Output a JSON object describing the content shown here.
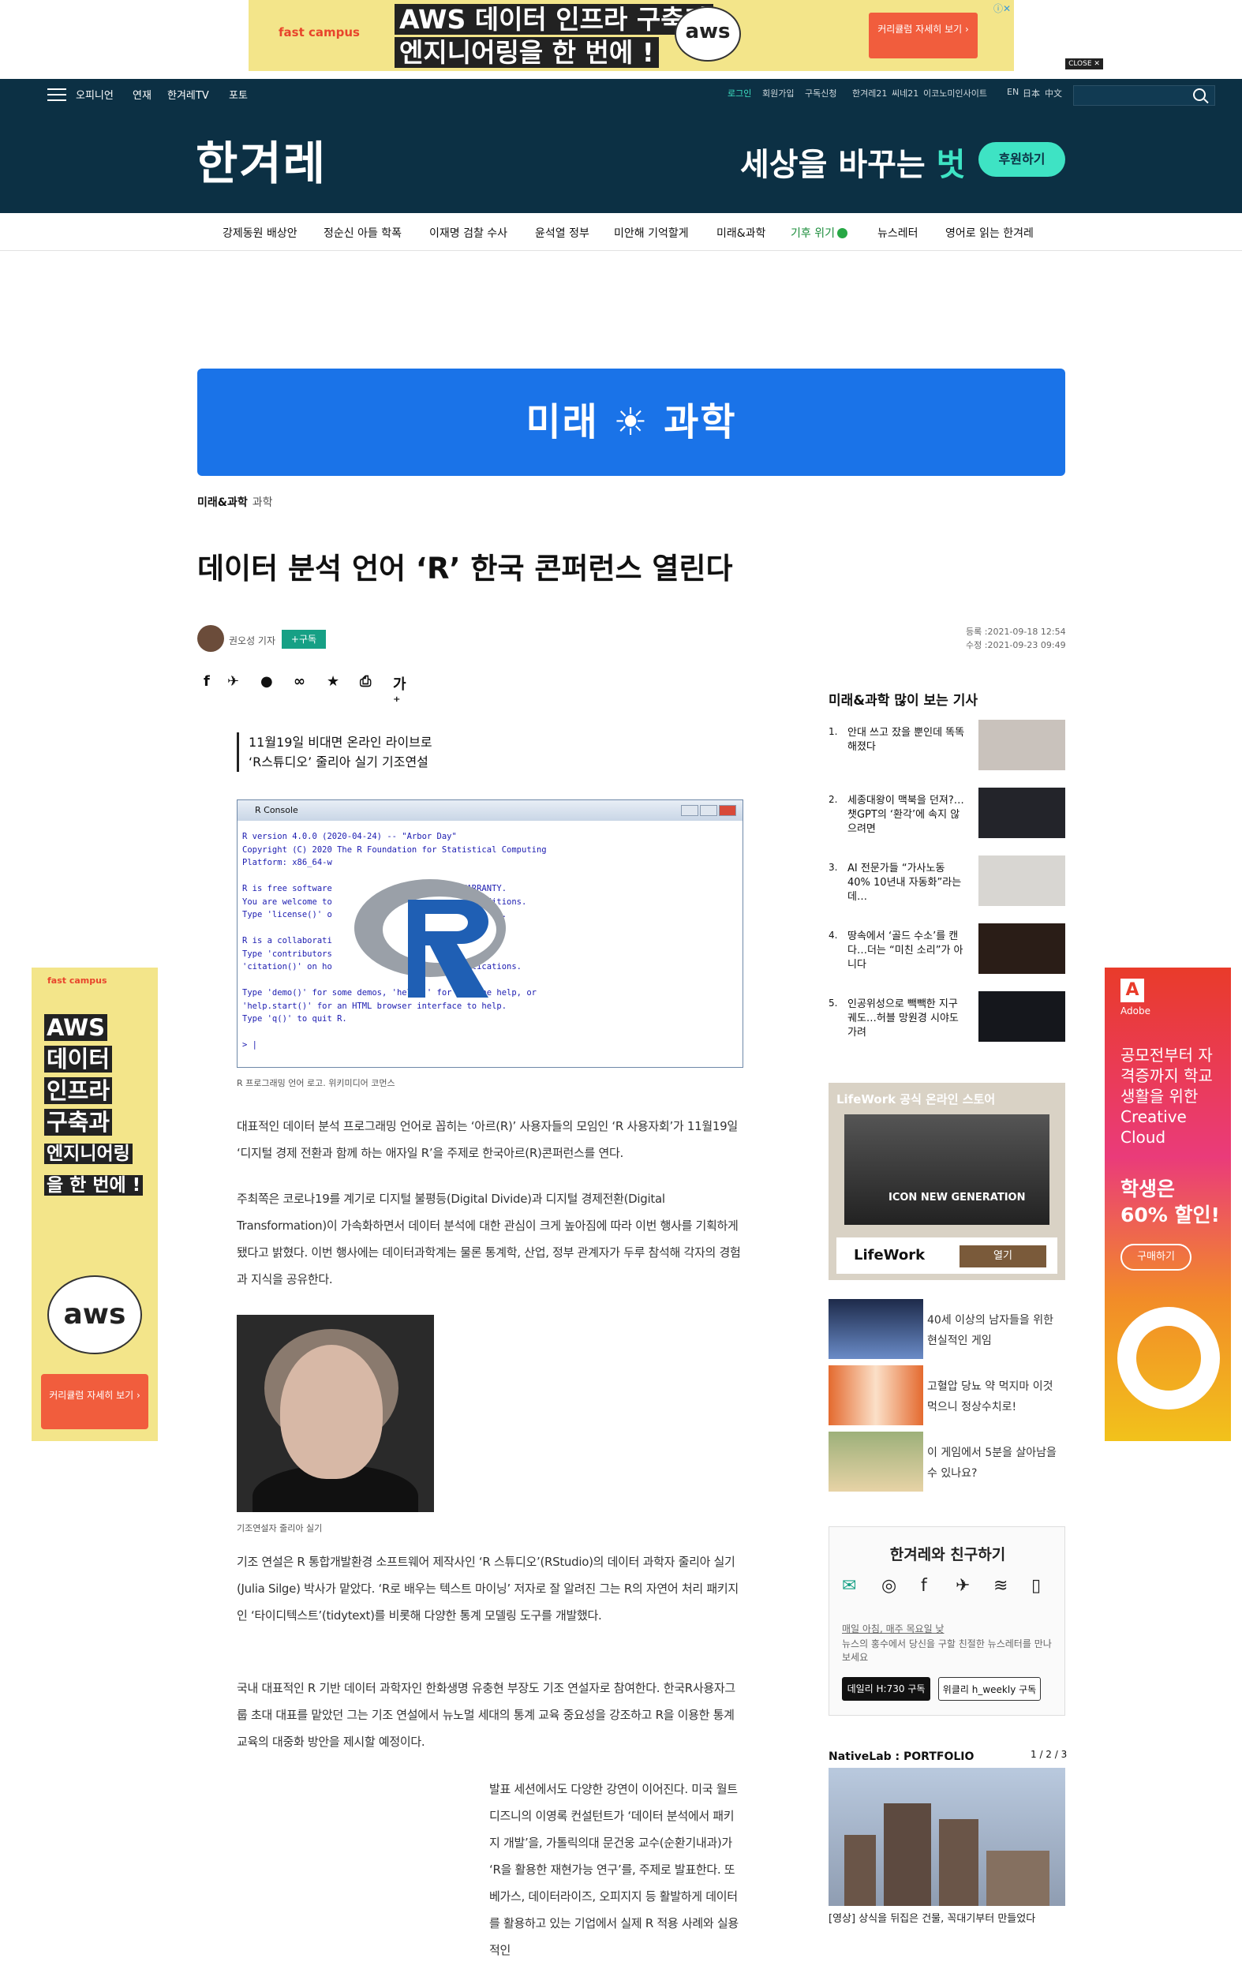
{
  "top_ad": {
    "brand": "fast campus",
    "headline_line1": "AWS 데이터 인프라 구축과",
    "headline_line2": "엔지니어링을 한 번에 !",
    "aws_logo": "aws",
    "cta": "커리큘럼 자세히 보기 ›",
    "ad_mark": "ⓘ✕",
    "close_label": "CLOSE ✕"
  },
  "header": {
    "nav": [
      "오피니언",
      "연재",
      "한겨레TV",
      "포토"
    ],
    "util": [
      "로그인",
      "회원가입",
      "구독신청",
      "한겨레21",
      "씨네21",
      "이코노미인사이트",
      "EN",
      "日本",
      "中文"
    ],
    "logo": "한겨레",
    "slogan_prefix": "세상을 바꾸는 ",
    "slogan_highlight": "벗",
    "support_button": "후원하기"
  },
  "topics": [
    "강제동원 배상안",
    "정순신 아들 학폭",
    "이재명 검찰 수사",
    "윤석열 정부",
    "미안해 기억할게",
    "미래&과학",
    "기후 위기",
    "뉴스레터",
    "영어로 읽는 한겨레"
  ],
  "section_banner": "미래 ☀ 과학",
  "breadcrumb": {
    "main": "미래&과학",
    "sub": "과학"
  },
  "article": {
    "title": "데이터 분석 언어 ‘R’ 한국 콘퍼런스 열린다",
    "reporter": "권오성 기자",
    "subscribe": "+구독",
    "registered": "등록 :2021-09-18 12:54",
    "modified": "수정 :2021-09-23 09:49",
    "summary_line1": "11월19일 비대면 온라인 라이브로",
    "summary_line2": "‘R스튜디오’ 줄리아 실기 기조연설",
    "console_title": "R Console",
    "console_text": "R version 4.0.0 (2020-04-24) -- \"Arbor Day\"\nCopyright (C) 2020 The R Foundation for Statistical Computing\nPlatform: x86_64-w\n\nR is free software                       NO WARRANTY.\nYou are welcome to                       tain conditions.\nType 'license()' o                       ion details.\n\nR is a collaborati                       ibutors.\nType 'contributors                       d\n'citation()' on ho                       n publications.\n\nType 'demo()' for some demos, 'help()' for on-line help, or\n'help.start()' for an HTML browser interface to help.\nType 'q()' to quit R.\n\n> |",
    "caption1": "R 프로그래밍 언어 로고. 위키미디어 코먼스",
    "para1": "대표적인 데이터 분석 프로그래밍 언어로 꼽히는 ‘아르(R)’ 사용자들의 모임인 ‘R 사용자회’가 11월19일 ‘디지털 경제 전환과 함께 하는 애자일 R’을 주제로 한국아르(R)콘퍼런스를 연다.",
    "para2": "주최쪽은 코로나19를 계기로 디지털 불평등(Digital Divide)과 디지털 경제전환(Digital Transformation)이 가속화하면서 데이터 분석에 대한 관심이 크게 높아짐에 따라 이번 행사를 기획하게 됐다고 밝혔다. 이번 행사에는 데이터과학계는 물론 통계학, 산업, 정부 관계자가 두루 참석해 각자의 경험과 지식을 공유한다.",
    "caption2": "기조연설자 줄리아 실기",
    "para3": "기조 연설은 R 통합개발환경 소프트웨어 제작사인 ‘R 스튜디오’(RStudio)의 데이터 과학자 줄리아 실기(Julia Silge) 박사가 맡았다. ‘R로 배우는 텍스트 마이닝’ 저자로 잘 알려진 그는 R의 자연어 처리 패키지인 ‘타이디텍스트’(tidytext)를 비롯해 다양한 통계 모델링 도구를 개발했다.",
    "para4": "국내 대표적인 R 기반 데이터 과학자인 한화생명 유충현 부장도 기조 연설자로 참여한다. 한국R사용자그룹 초대 대표를 맡았던 그는 기조 연설에서 뉴노멀 세대의 통계 교육 중요성을 강조하고 R을 이용한 통계 교육의 대중화 방안을 제시할 예정이다.",
    "para5": "발표 세션에서도 다양한 강연이 이어진다. 미국 월트 디즈니의 이영록 컨설턴트가 ‘데이터 분석에서 패키지 개발’을, 가톨릭의대 문건웅 교수(순환기내과)가 ‘R을 활용한 재현가능 연구’를, 주제로 발표한다. 또 베가스, 데이터라이즈, 오피지지 등 활발하게 데이터를 활용하고 있는 기업에서 실제 R 적용 사례와 실용적인"
  },
  "popular": {
    "title": "미래&과학 많이 보는 기사",
    "items": [
      {
        "num": "1.",
        "text": "안대 쓰고 잤을 뿐인데 똑똑해졌다"
      },
      {
        "num": "2.",
        "text": "세종대왕이 맥북을 던져?…챗GPT의 ‘환각’에 속지 않으려면"
      },
      {
        "num": "3.",
        "text": "AI 전문가들 “가사노동 40% 10년내 자동화”라는데…"
      },
      {
        "num": "4.",
        "text": "땅속에서 ‘골드 수소’를 캔다…더는 “미친 소리”가 아니다"
      },
      {
        "num": "5.",
        "text": "인공위성으로 빽빽한 지구궤도…허블 망원경 시야도 가려"
      }
    ]
  },
  "lifework_ad": {
    "header": "LifeWork 공식 온라인 스토어",
    "tagline": "ICON NEW GENERATION",
    "brand": "LifeWork",
    "button": "열기"
  },
  "game_ads": [
    {
      "text": "40세 이상의 남자들을 위한 현실적인 게임"
    },
    {
      "text": "고혈압 당뇨 약 먹지마 이것 먹으니 정상수치로!"
    },
    {
      "text": "이 게임에서 5분을 살아남을 수 있나요?"
    }
  ],
  "friends": {
    "title": "한겨레와 친구하기",
    "newsletter_link": "매일 아침, 매주 목요일 낮",
    "newsletter_desc": "뉴스의 홍수에서 당신을 구할 친절한 뉴스레터를 만나보세요",
    "button1": "데일리 H:730 구독",
    "button2": "위클리 h_weekly 구독"
  },
  "native": {
    "label": "NativeLab : PORTFOLIO",
    "pages": "1 / 2 / 3",
    "caption": "[영상] 상식을 뒤집은 건물, 꼭대기부터 만들었다"
  },
  "left_ad": {
    "brand": "fast campus",
    "lines": [
      "AWS",
      "데이터",
      "인프라",
      "구축과",
      "엔지니어링",
      "을 한 번에 !"
    ],
    "aws": "aws",
    "cta": "커리큘럼 자세히 보기 ›"
  },
  "right_ad": {
    "brand": "Adobe",
    "pitch": "공모전부터 자격증까지 학교생활을 위한 Creative Cloud",
    "big": "학생은 60% 할인!",
    "cta": "구매하기"
  }
}
